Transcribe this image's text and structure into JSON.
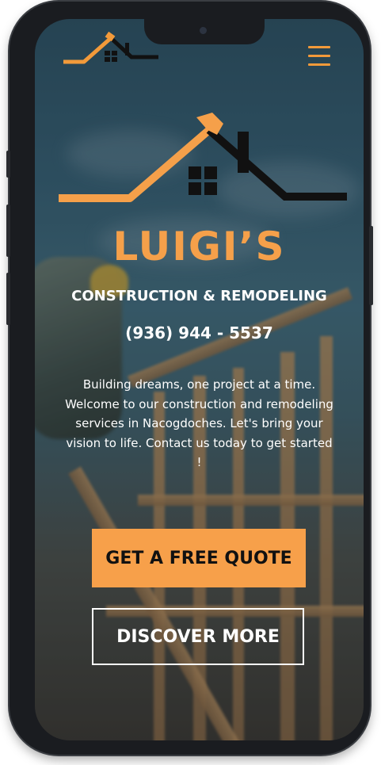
{
  "site": {
    "brand_name": "LUIGI’S",
    "subtitle": "CONSTRUCTION & REMODELING",
    "phone": "(936) 944 - 5537",
    "description": "Building dreams, one project at a time. Welcome to our construction and remodeling services in Nacogdoches. Let's bring your vision to life. Contact us today to get started !"
  },
  "nav": {
    "logo_icon": "house-roof-logo",
    "menu_icon": "hamburger-menu-icon"
  },
  "buttons": {
    "quote_label": "GET A FREE QUOTE",
    "discover_label": "DISCOVER MORE"
  },
  "colors": {
    "accent": "#f5a04a",
    "text": "#ffffff",
    "logo_dark": "#111111",
    "device_frame": "#1a1c20"
  }
}
